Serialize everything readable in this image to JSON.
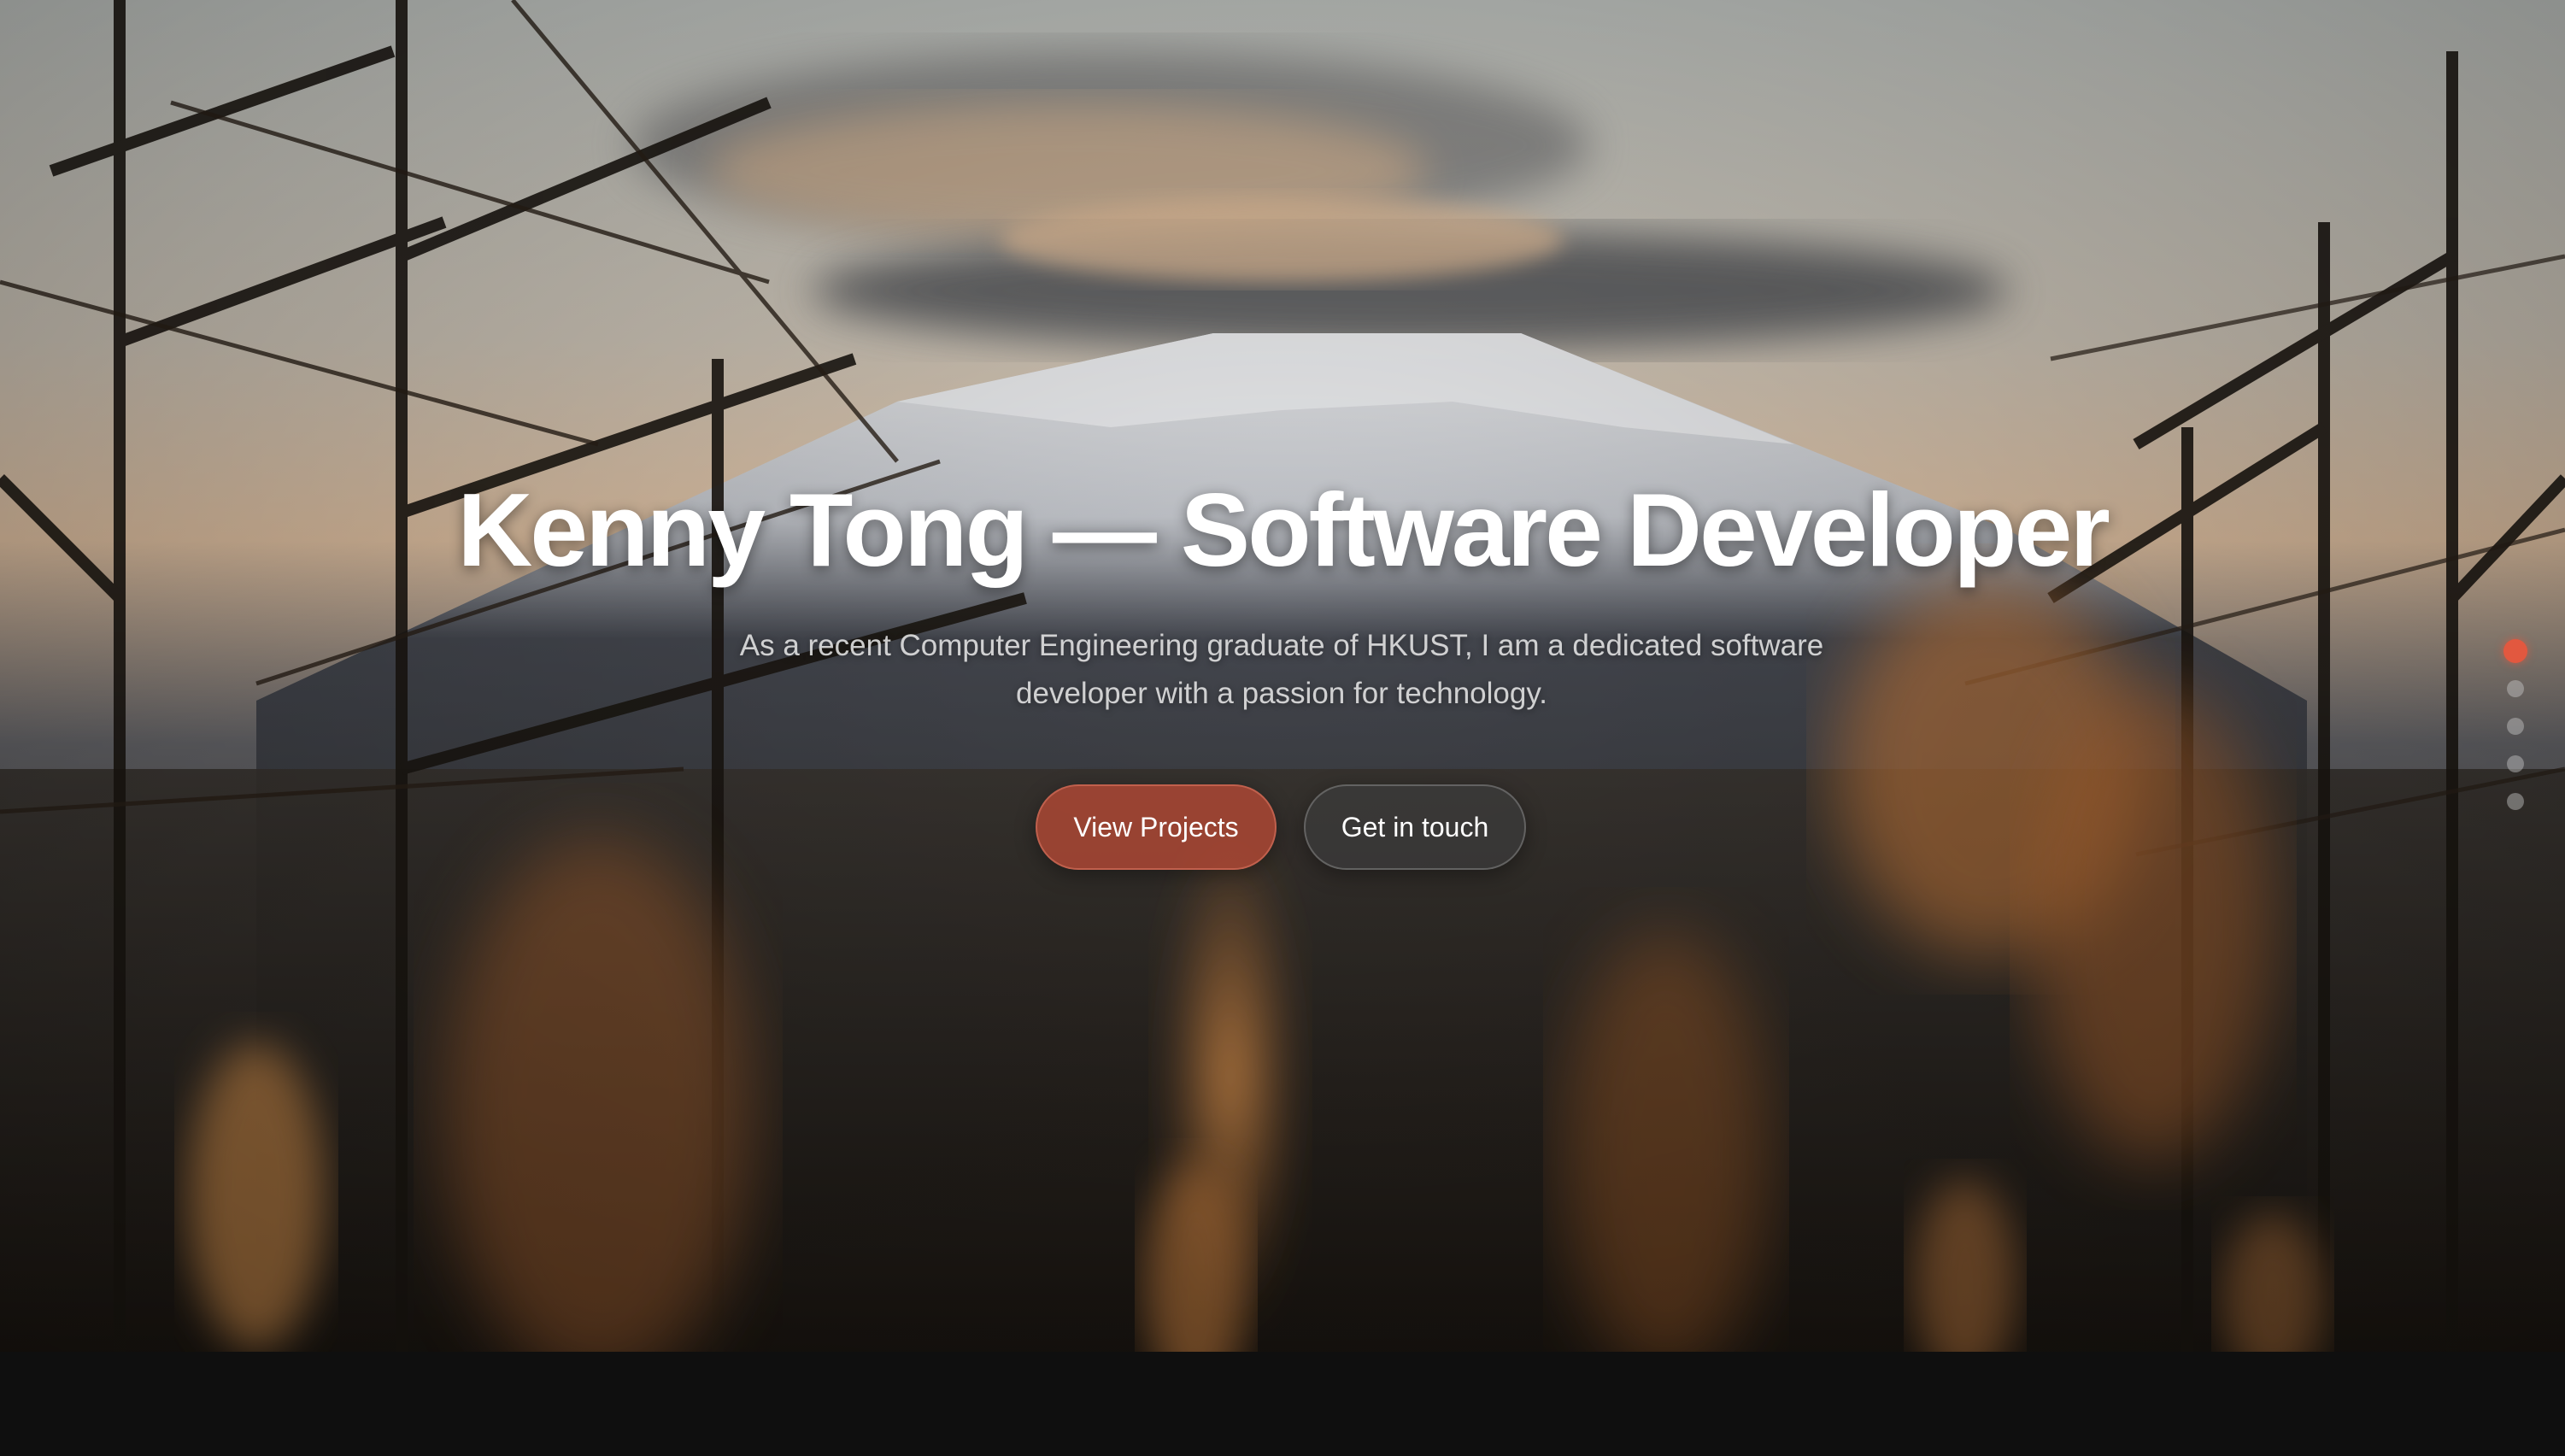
{
  "hero": {
    "title": "Kenny Tong — Software Developer",
    "subtitle": "As a recent Computer Engineering graduate of HKUST, I am a dedicated software developer with a passion for technology."
  },
  "actions": {
    "primary_label": "View Projects",
    "secondary_label": "Get in touch"
  },
  "section_nav": {
    "count": 5,
    "active_index": 0
  },
  "colors": {
    "accent": "#e2583f",
    "primary_button": "#b04834",
    "footer": "#0f0f0f"
  }
}
